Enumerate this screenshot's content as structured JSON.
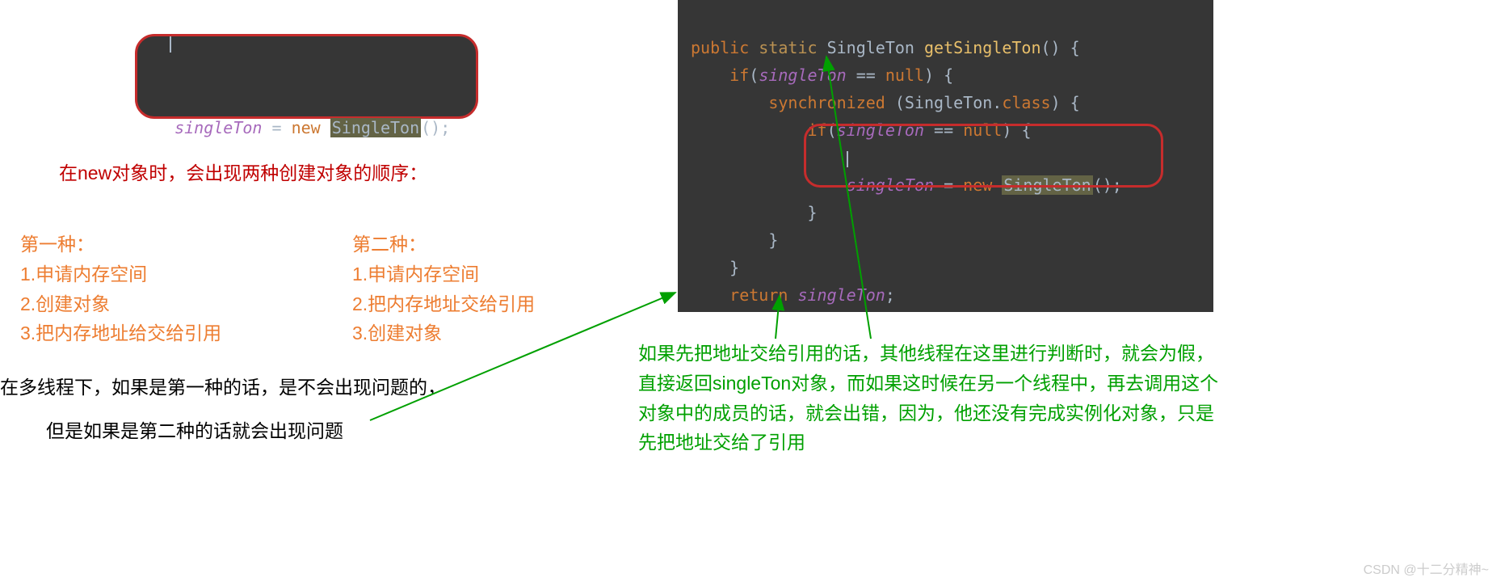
{
  "colors": {
    "keyword": "#cc7832",
    "var": "#a76abc",
    "type": "#a9b7c6",
    "method_name": "#e8bf6a",
    "highlight_box": "#c62c2c",
    "red_text": "#c00000",
    "orange_text": "#ed7d31",
    "green_text": "#00a000"
  },
  "code_small": {
    "var": "singleTon",
    "assign": " = ",
    "new_kw": "new",
    "sp": " ",
    "ctor": "SingleTon",
    "tail": "();"
  },
  "code_large": {
    "l1": {
      "kw1": "public",
      "kw2": " static ",
      "type": "SingleTon",
      "sp": " ",
      "method": "getSingleTon",
      "tail": "() {"
    },
    "l2": {
      "kw": "if",
      "paren_open": "(",
      "var": "singleTon",
      "cmp": " == ",
      "null_kw": "null",
      "tail": ") {"
    },
    "l3": {
      "kw": "synchronized",
      "open": " (",
      "type": "SingleTon",
      "dot": ".",
      "cls": "class",
      "tail": ") {"
    },
    "l4": {
      "kw": "if",
      "paren_open": "(",
      "var": "singleTon",
      "cmp": " == ",
      "null_kw": "null",
      "tail": ") {"
    },
    "l5": {
      "var": "singleTon",
      "assign": " = ",
      "new_kw": "new",
      "sp": " ",
      "ctor": "SingleTon",
      "tail": "();"
    },
    "l6": "}",
    "l7": "}",
    "l8": "}",
    "l9": {
      "kw": "return",
      "sp": " ",
      "var": "singleTon",
      "tail": ";"
    }
  },
  "text": {
    "note_red": "在new对象时，会出现两种创建对象的顺序：",
    "first": {
      "title": "第一种：",
      "s1": "1.申请内存空间",
      "s2": "2.创建对象",
      "s3": "3.把内存地址给交给引用"
    },
    "second": {
      "title": "第二种：",
      "s1": "1.申请内存空间",
      "s2": "2.把内存地址交给引用",
      "s3": "3.创建对象"
    },
    "black1": "在多线程下，如果是第一种的话，是不会出现问题的，",
    "black2": "但是如果是第二种的话就会出现问题",
    "green_note": "如果先把地址交给引用的话，其他线程在这里进行判断时，就会为假，直接返回singleTon对象，而如果这时候在另一个线程中，再去调用这个对象中的成员的话，就会出错，因为，他还没有完成实例化对象，只是先把地址交给了引用"
  },
  "watermark": "CSDN @十二分精神~"
}
